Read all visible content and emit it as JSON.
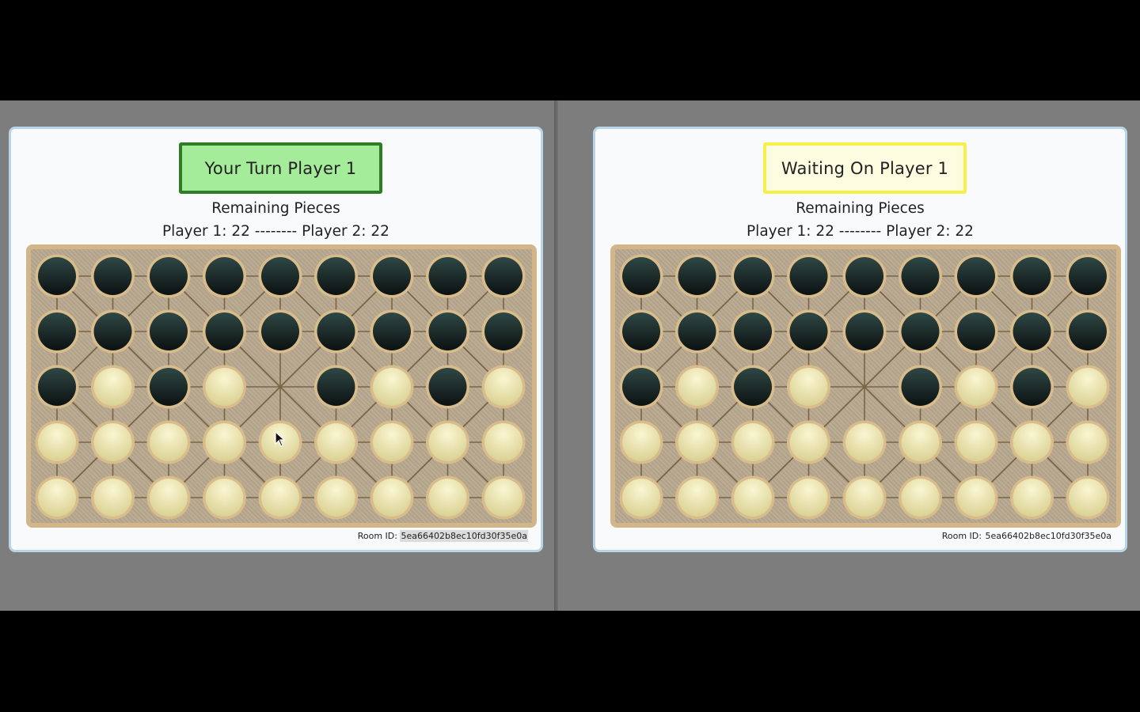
{
  "panels": [
    {
      "status_text": "Your Turn Player 1",
      "status_state": "active",
      "remaining_title": "Remaining Pieces",
      "scores_text": "Player 1: 22 -------- Player 2: 22",
      "room_label": "Room ID:",
      "room_id": "5ea66402b8ec10fd30f35e0a"
    },
    {
      "status_text": "Waiting On Player 1",
      "status_state": "waiting",
      "remaining_title": "Remaining Pieces",
      "scores_text": "Player 1: 22 -------- Player 2: 22",
      "room_label": "Room ID:",
      "room_id": "5ea66402b8ec10fd30f35e0a"
    }
  ],
  "board": {
    "rows": 5,
    "cols": 9,
    "cells": [
      "DDDDDDDDD",
      "DDDDDDDDD",
      "DLDL.DLDL",
      "LLLLLLLLL",
      "LLLLLLLLL"
    ],
    "legend": {
      "D": "dark-piece",
      "L": "light-piece",
      ".": "empty-point"
    }
  },
  "colors": {
    "active_status_bg": "#a5ec9a",
    "active_status_border": "#2e7d24",
    "waiting_status_bg": "#fcfde0",
    "waiting_status_border": "#f6f048",
    "board_bg": "#b8a88f",
    "board_border": "#d2b589",
    "line": "#6e5a3c",
    "dark_piece_top": "#2f4845",
    "dark_piece_bottom": "#0b1111",
    "light_piece_top": "#faf6d2",
    "light_piece_bottom": "#d8cf8f",
    "piece_ring": "#d8bc8c"
  },
  "icons": {
    "cursor": "mouse-pointer-icon"
  }
}
